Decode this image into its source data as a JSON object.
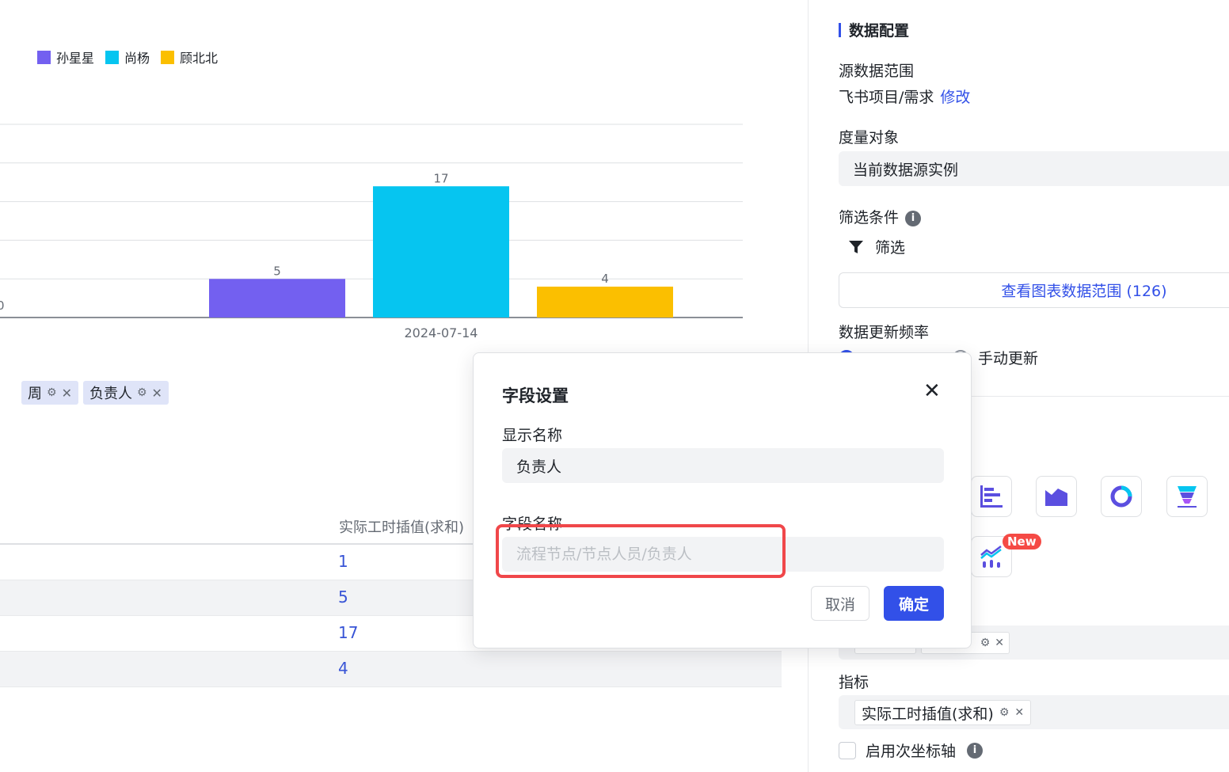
{
  "chart_data": {
    "type": "bar",
    "categories": [
      "2024-07-14"
    ],
    "series": [
      {
        "name": "孙星星",
        "values": [
          5
        ],
        "color": "#7360f0"
      },
      {
        "name": "尚杨",
        "values": [
          17
        ],
        "color": "#06c5f0"
      },
      {
        "name": "顾北北",
        "values": [
          4
        ],
        "color": "#fbbf00"
      }
    ],
    "data_labels": [
      "5",
      "17",
      "4"
    ],
    "baseline_tick_label": "0",
    "ylim": [
      0,
      18
    ],
    "grid": true,
    "legend_position": "top-left",
    "title": "",
    "xlabel": "",
    "ylabel": ""
  },
  "dimension_tags": [
    {
      "label": "周",
      "gear_icon": "gear-icon",
      "close_icon": "close-icon"
    },
    {
      "label": "负责人",
      "gear_icon": "gear-icon",
      "close_icon": "close-icon"
    }
  ],
  "table": {
    "column_header": "实际工时插值(求和)",
    "rows": [
      "1",
      "5",
      "17",
      "4"
    ]
  },
  "right_panel": {
    "section_title": "数据配置",
    "source_range_label": "源数据范围",
    "source_range_value": "飞书项目/需求",
    "source_range_modify": "修改",
    "measure_object_label": "度量对象",
    "measure_object_value": "当前数据源实例",
    "filter_label": "筛选条件",
    "filter_button": "筛选",
    "view_range_button": "查看图表数据范围 (126)",
    "update_freq_label": "数据更新频率",
    "manual_update": "手动更新",
    "new_badge": "New",
    "metrics_label": "指标",
    "metric_tag": "实际工时插值(求和)",
    "secondary_axis_label": "启用次坐标轴"
  },
  "dialog": {
    "title": "字段设置",
    "display_name_label": "显示名称",
    "display_name_value": "负责人",
    "field_name_label": "字段名称",
    "field_name_placeholder": "流程节点/节点人员/负责人",
    "cancel_label": "取消",
    "confirm_label": "确定"
  },
  "colors": {
    "accent": "#3250e8",
    "highlight": "#f0474a"
  }
}
